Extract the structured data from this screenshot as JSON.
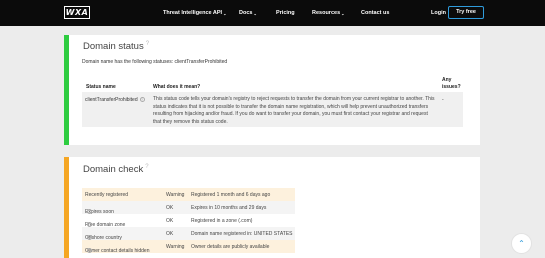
{
  "header": {
    "logo_text": "WXA",
    "nav": [
      {
        "label": "Threat Intelligence API",
        "dropdown": true
      },
      {
        "label": "Docs",
        "dropdown": true
      },
      {
        "label": "Pricing",
        "dropdown": false
      },
      {
        "label": "Resources",
        "dropdown": true
      },
      {
        "label": "Contact us",
        "dropdown": false
      }
    ],
    "login_label": "Login",
    "try_free_label": "Try free"
  },
  "domain_status": {
    "title": "Domain status",
    "intro": "Domain name has the following statuses: clientTransferProhibited",
    "columns": {
      "status": "Status name",
      "meaning": "What does it mean?",
      "issues": "Any issues?"
    },
    "rows": [
      {
        "status": "clientTransferProhibited",
        "meaning": "This status code tells your domain's registry to reject requests to transfer the domain from your current registrar to another. This status indicates that it is not possible to transfer the domain name registration, which will help prevent unauthorized transfers resulting from hijacking and/or fraud. If you do want to transfer your domain, you must first contact your registrar and request that they remove this status code.",
        "issues": "-"
      }
    ]
  },
  "domain_check": {
    "title": "Domain check",
    "rows": [
      {
        "check": "Recently registered",
        "result": "Warning",
        "detail": "Registered 1 month and 6 days ago",
        "level": "warn",
        "info": false
      },
      {
        "check": "Expires soon",
        "result": "OK",
        "detail": "Expires in 10 months and 29 days",
        "level": "ok",
        "info": true
      },
      {
        "check": "Free domain zone",
        "result": "OK",
        "detail": "Registered in a zone (.com)",
        "level": "ok",
        "info": true
      },
      {
        "check": "Offshore country",
        "result": "OK",
        "detail": "Domain name registered in: UNITED STATES",
        "level": "ok",
        "info": true
      },
      {
        "check": "Owner contact details hidden",
        "result": "Warning",
        "detail": "Owner details are publicly available",
        "level": "warn",
        "info": true
      }
    ]
  },
  "colors": {
    "topbar": "#0b0b0b",
    "status_bar": "#2ecc40",
    "check_bar": "#f5a623",
    "warn_row": "#fdf1dd",
    "accent": "#2f9bdb"
  },
  "scroll_up_icon": "chevron-up-icon"
}
